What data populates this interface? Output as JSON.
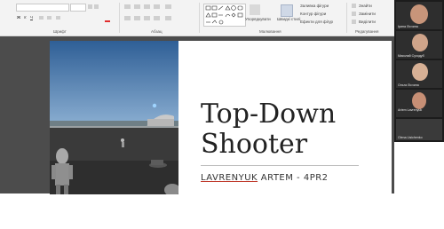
{
  "ribbon": {
    "groups": {
      "font": "Шрифт",
      "paragraph": "Абзац",
      "drawing": "Малювання",
      "editing": "Редагування"
    },
    "buttons": {
      "arrange": "Упорядкувати",
      "quick_styles": "Швидкі стилі",
      "shape_fill": "Заливка фігури",
      "shape_outline": "Контур фігури",
      "shape_effects": "Ефекти для фігур",
      "find": "Знайти",
      "replace": "Замінити",
      "select": "Виділити"
    }
  },
  "slide": {
    "title_line1": "Top-Down",
    "title_line2": "Shooter",
    "author_name": "LAVRENYUK",
    "author_rest": " ARTEM - 4PR2"
  },
  "participants": [
    {
      "label": "Ірина Лісчина"
    },
    {
      "label": "Миколай Суходуб"
    },
    {
      "label": "Ольга Лісчина"
    },
    {
      "label": "Artem Lavrenyuk"
    },
    {
      "label": "Olena Lisichenko"
    }
  ],
  "colors": {
    "ribbon_bg": "#f3f3f3",
    "stage_bg": "#4c4c4c",
    "panel_bg": "#1c1c1c",
    "underline_accent": "#c0392b"
  }
}
